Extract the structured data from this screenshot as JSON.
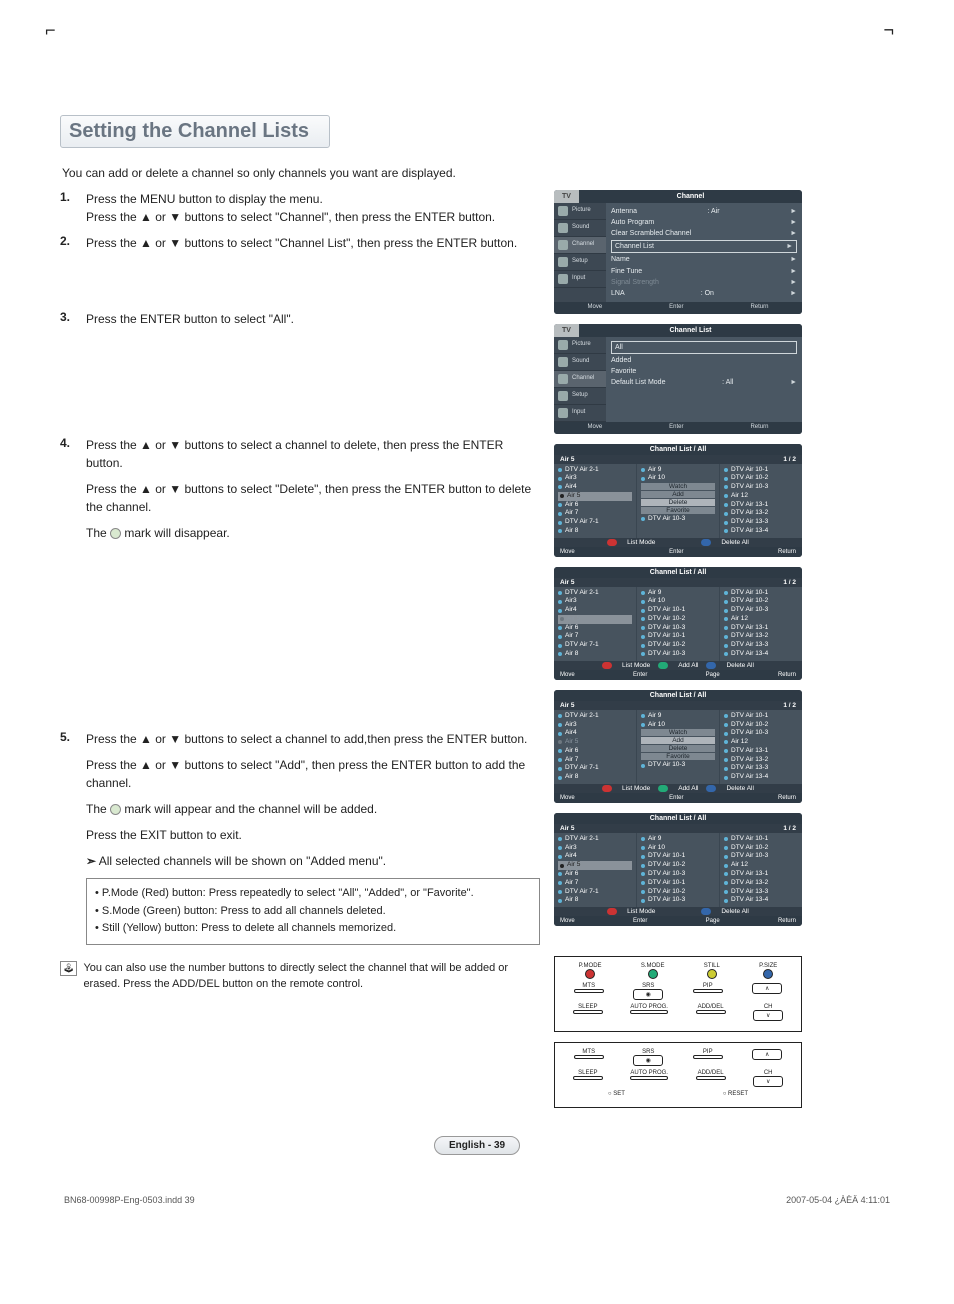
{
  "title": "Setting the Channel Lists",
  "intro": "You can add or delete a channel so only channels you want are displayed.",
  "steps": {
    "s1a": "Press the MENU button to display the menu.",
    "s1b": "Press the ▲ or ▼ buttons to select \"Channel\", then press the ENTER button.",
    "s2": "Press the ▲ or ▼ buttons to select \"Channel List\", then press the ENTER button.",
    "s3": "Press the ENTER button to select \"All\".",
    "s4a": "Press the ▲ or ▼ buttons to select a channel to delete, then press the ENTER button.",
    "s4b": "Press the ▲ or ▼ buttons to select \"Delete\", then press the ENTER button to delete the channel.",
    "s4c_pre": "The ",
    "s4c_post": " mark will disappear.",
    "s5a": "Press the ▲ or ▼ buttons to select a channel to add,then press the ENTER button.",
    "s5b": "Press the ▲ or ▼ buttons to select \"Add\", then press the ENTER button to add the channel.",
    "s5c_pre": "The ",
    "s5c_post": " mark will appear and the channel will be added.",
    "s5d": "Press the EXIT button to exit.",
    "s5e": "All selected channels will be shown on \"Added menu\"."
  },
  "tips": {
    "t1": "• P.Mode (Red) button: Press repeatedly to select \"All\", \"Added\", or \"Favorite\".",
    "t2": "• S.Mode (Green) button: Press to add all channels deleted.",
    "t3": "• Still (Yellow) button: Press to delete all channels memorized."
  },
  "note": "You can also use the number buttons to directly select the channel that will be added or erased. Press the ADD/DEL button on the remote control.",
  "pagefoot": "English - 39",
  "printline_left": "BN68-00998P-Eng-0503.indd   39",
  "printline_right": "2007-05-04   ¿ÀÈÄ 4:11:01",
  "osd1": {
    "tab": "TV",
    "title": "Channel",
    "side": [
      "Picture",
      "Sound",
      "Channel",
      "Setup",
      "Input"
    ],
    "rows": [
      {
        "k": "Antenna",
        "v": ": Air",
        "arr": "►"
      },
      {
        "k": "Auto Program",
        "v": "",
        "arr": "►"
      },
      {
        "k": "Clear Scrambled Channel",
        "v": "",
        "arr": "►"
      },
      {
        "k": "Channel List",
        "v": "",
        "arr": "►",
        "boxed": true
      },
      {
        "k": "Name",
        "v": "",
        "arr": "►"
      },
      {
        "k": "Fine Tune",
        "v": "",
        "arr": "►"
      },
      {
        "k": "Signal Strength",
        "v": "",
        "arr": "►",
        "dim": true
      },
      {
        "k": "LNA",
        "v": ": On",
        "arr": "►"
      }
    ],
    "foot": [
      "Move",
      "Enter",
      "Return"
    ]
  },
  "osd2": {
    "tab": "TV",
    "title": "Channel List",
    "side": [
      "Picture",
      "Sound",
      "Channel",
      "Setup",
      "Input"
    ],
    "rows": [
      {
        "k": "All",
        "v": "",
        "boxed": true
      },
      {
        "k": "Added",
        "v": ""
      },
      {
        "k": "Favorite",
        "v": ""
      },
      {
        "k": "Default List Mode",
        "v": ": All",
        "arr": "►"
      }
    ],
    "foot": [
      "Move",
      "Enter",
      "Return"
    ]
  },
  "cl": {
    "title": "Channel List / All",
    "current": "Air 5",
    "page": "1 / 2",
    "col_base_1": [
      "DTV Air 2-1",
      "Air3",
      "Air4",
      "Air 5",
      "Air 6",
      "Air 7",
      "DTV Air 7-1",
      "Air 8"
    ],
    "col_base_3": [
      "DTV Air 10-1",
      "DTV Air 10-2",
      "DTV Air 10-3",
      "Air 12",
      "DTV Air 13-1",
      "DTV Air 13-2",
      "DTV Air 13-3",
      "DTV Air 13-4"
    ],
    "panel1_col2_top": [
      "Air 9",
      "Air 10"
    ],
    "panel1_ctx": [
      "Watch",
      "Add",
      "Delete",
      "Favorite"
    ],
    "panel1_ctx_sel": "Delete",
    "panel1_col2_bot": [
      "DTV Air 10-3"
    ],
    "panel1_bar": [
      "List Mode",
      "Delete All"
    ],
    "panel2_col2": [
      "Air 9",
      "Air 10",
      "DTV Air 10-1",
      "DTV Air 10-2",
      "DTV Air 10-3",
      "DTV Air 10-1",
      "DTV Air 10-2",
      "DTV Air 10-3"
    ],
    "panel2_bar": [
      "List Mode",
      "Add All",
      "Delete All"
    ],
    "panel3_col2_top": [
      "Air 9",
      "Air 10"
    ],
    "panel3_ctx": [
      "Watch",
      "Add",
      "Delete",
      "Favorite"
    ],
    "panel3_ctx_sel": "Add",
    "panel3_col2_bot": [
      "DTV Air 10-3"
    ],
    "panel3_bar": [
      "List Mode",
      "Add All",
      "Delete All"
    ],
    "panel4_col2": [
      "Air 9",
      "Air 10",
      "DTV Air 10-1",
      "DTV Air 10-2",
      "DTV Air 10-3",
      "DTV Air 10-1",
      "DTV Air 10-2",
      "DTV Air 10-3"
    ],
    "panel4_bar": [
      "List Mode",
      "Delete All"
    ],
    "foot_a": [
      "Move",
      "Enter",
      "Return"
    ],
    "foot_b": [
      "Move",
      "Enter",
      "Page",
      "Return"
    ]
  },
  "remote1": {
    "row1": [
      "P.MODE",
      "S.MODE",
      "STILL",
      "P.SIZE"
    ],
    "row2": [
      "MTS",
      "SRS",
      "PIP"
    ],
    "row3": [
      "SLEEP",
      "AUTO PROG.",
      "ADD/DEL",
      "CH"
    ]
  },
  "remote2": {
    "row1": [
      "MTS",
      "SRS",
      "PIP"
    ],
    "row2": [
      "SLEEP",
      "AUTO PROG.",
      "ADD/DEL",
      "CH"
    ],
    "row3": [
      "SET",
      "RESET"
    ]
  }
}
